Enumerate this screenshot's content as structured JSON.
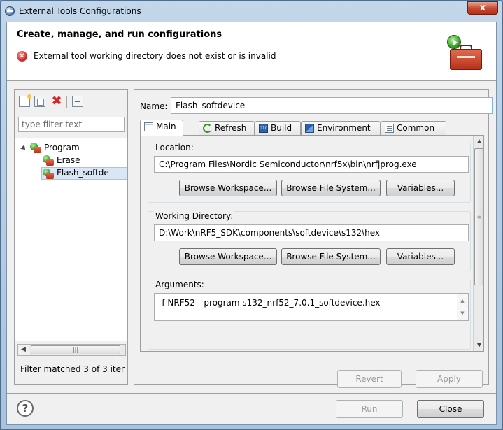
{
  "window": {
    "title": "External Tools Configurations",
    "close_glyph": "x"
  },
  "header": {
    "title": "Create, manage, and run configurations",
    "message": "External tool working directory does not exist or is invalid"
  },
  "left_panel": {
    "filter_placeholder": "type filter text",
    "tree": [
      {
        "label": "Program",
        "level": 0,
        "expanded": true
      },
      {
        "label": "Erase",
        "level": 1
      },
      {
        "label": "Flash_softde",
        "level": 1,
        "selected": true
      }
    ],
    "status": "Filter matched 3 of 3 iter"
  },
  "right_panel": {
    "name_label": "Name:",
    "name_value": "Flash_softdevice",
    "tabs": [
      {
        "label": "Main",
        "icon": "main-tab-icon",
        "active": true
      },
      {
        "label": "Refresh",
        "icon": "refresh-icon"
      },
      {
        "label": "Build",
        "icon": "build-icon"
      },
      {
        "label": "Environment",
        "icon": "environment-icon"
      },
      {
        "label": "Common",
        "icon": "common-icon"
      }
    ],
    "location": {
      "label": "Location:",
      "value": "C:\\Program Files\\Nordic Semiconductor\\nrf5x\\bin\\nrfjprog.exe",
      "buttons": [
        "Browse Workspace...",
        "Browse File System...",
        "Variables..."
      ]
    },
    "working_directory": {
      "label": "Working Directory:",
      "value": "D:\\Work\\nRF5_SDK\\components\\softdevice\\s132\\hex",
      "buttons": [
        "Browse Workspace...",
        "Browse File System...",
        "Variables..."
      ]
    },
    "arguments": {
      "label": "Arguments:",
      "value": "-f NRF52 --program s132_nrf52_7.0.1_softdevice.hex"
    },
    "revert_label": "Revert",
    "apply_label": "Apply"
  },
  "footer": {
    "help_glyph": "?",
    "run_label": "Run",
    "close_label": "Close"
  },
  "colors": {
    "title_bg": "#b9d1ea",
    "close_red": "#c94b31",
    "error_red": "#d62a2a",
    "focus_blue": "#7eb4ea"
  }
}
